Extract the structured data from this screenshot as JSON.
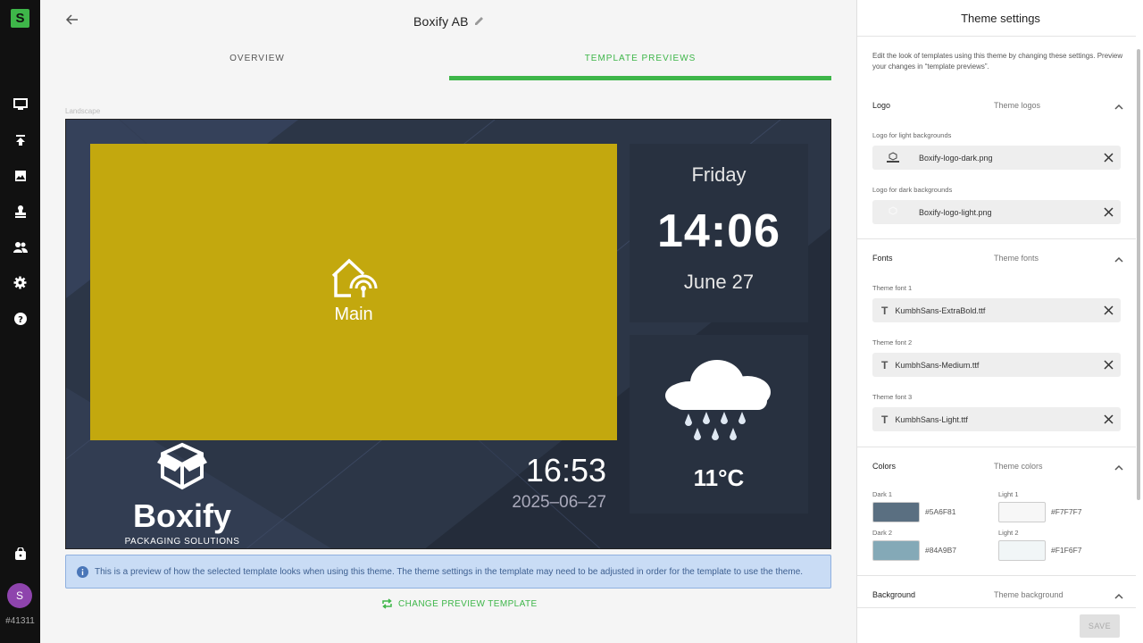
{
  "rail": {
    "logo": "S",
    "icons": [
      "monitor-icon",
      "upload-icon",
      "image-icon",
      "stamp-icon",
      "users-icon",
      "gear-icon",
      "help-icon"
    ],
    "bag_icon": "bag-icon",
    "avatar": "S",
    "account_id": "#41311"
  },
  "header": {
    "title": "Boxify AB"
  },
  "tabs": [
    {
      "label": "OVERVIEW"
    },
    {
      "label": "TEMPLATE PREVIEWS"
    }
  ],
  "preview": {
    "orientation_label": "Landscape",
    "main_zone_label": "Main",
    "day": "Friday",
    "time": "14:06",
    "date": "June 27",
    "temperature": "11°C",
    "brand_name": "Boxify",
    "brand_sub": "PACKAGING SOLUTIONS",
    "clock": "16:53",
    "clock_date": "2025–06–27",
    "colors": {
      "main_zone": "#c3a80e",
      "background": "#2c3647",
      "widget": "#283140"
    }
  },
  "info": "This is a preview of how the selected template looks when using this theme. The theme settings in the template may need to be adjusted in order for the template to use the theme.",
  "change_button": "CHANGE PREVIEW TEMPLATE",
  "panel": {
    "title": "Theme settings",
    "description": "Edit the look of templates using this theme by changing these settings. Preview your changes in “template previews”.",
    "logo_section": {
      "title": "Logo",
      "subtitle": "Theme logos",
      "light_label": "Logo for light backgrounds",
      "light_file": "Boxify-logo-dark.png",
      "dark_label": "Logo for dark backgrounds",
      "dark_file": "Boxify-logo-light.png"
    },
    "fonts_section": {
      "title": "Fonts",
      "subtitle": "Theme fonts",
      "fonts": [
        {
          "label": "Theme font 1",
          "file": "KumbhSans-ExtraBold.ttf"
        },
        {
          "label": "Theme font 2",
          "file": "KumbhSans-Medium.ttf"
        },
        {
          "label": "Theme font 3",
          "file": "KumbhSans-Light.ttf"
        }
      ]
    },
    "colors_section": {
      "title": "Colors",
      "subtitle": "Theme colors",
      "dark1": {
        "label": "Dark 1",
        "hex": "#5A6F81"
      },
      "light1": {
        "label": "Light 1",
        "hex": "#F7F7F7"
      },
      "dark2": {
        "label": "Dark 2",
        "hex": "#84A9B7"
      },
      "light2": {
        "label": "Light 2",
        "hex": "#F1F6F7"
      }
    },
    "background_section": {
      "title": "Background",
      "subtitle": "Theme background"
    },
    "save": "SAVE"
  }
}
